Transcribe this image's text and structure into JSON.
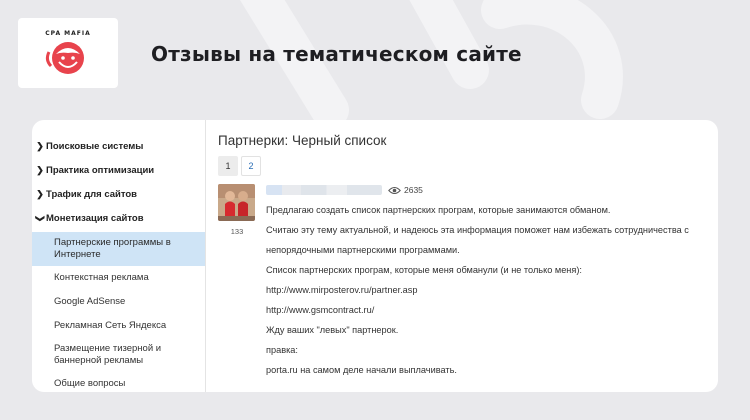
{
  "brand": {
    "logo_text": "CPA MAFIA",
    "accent": "#e8434c"
  },
  "headline": "Отзывы на тематическом сайте",
  "sidebar": {
    "categories": [
      {
        "label": "Поисковые системы"
      },
      {
        "label": "Практика оптимизации"
      },
      {
        "label": "Трафик для сайтов"
      },
      {
        "label": "Монетизация сайтов"
      }
    ],
    "subitems": [
      {
        "label": "Партнерские программы в Интернете",
        "active": true
      },
      {
        "label": "Контекстная реклама"
      },
      {
        "label": "Google AdSense"
      },
      {
        "label": "Рекламная Сеть Яндекса"
      },
      {
        "label": "Размещение тизерной и баннерной рекламы"
      },
      {
        "label": "Общие вопросы"
      }
    ]
  },
  "thread": {
    "title": "Партнерки: Черный список",
    "pages": [
      "1",
      "2"
    ],
    "post": {
      "author_count": "133",
      "views": "2635",
      "lines": [
        "Предлагаю создать список партнерских програм, которые занимаются обманом.",
        "Считаю эту тему актуальной, и надеюсь эта информация поможет нам избежать сотрудничества с",
        "непорядочными партнерскими программами.",
        "Список партнерских програм, которые меня обманули (и не только меня):",
        "http://www.mirposterov.ru/partner.asp",
        "http://www.gsmcontract.ru/",
        "Жду ваших \"левых\" партнерок.",
        "правка:",
        "porta.ru на самом деле начали выплачивать."
      ]
    }
  }
}
